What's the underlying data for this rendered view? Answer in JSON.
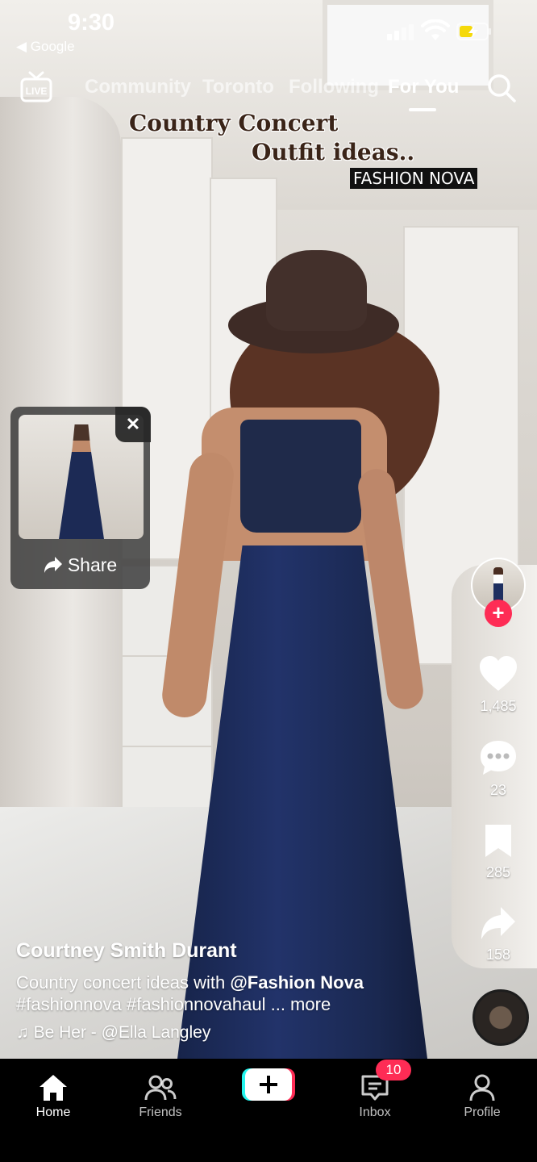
{
  "status_bar": {
    "time": "9:30",
    "back_app": "◀ Google"
  },
  "top_nav": {
    "tabs": [
      "Community",
      "Toronto",
      "Following",
      "For You"
    ],
    "active_tab": "For You",
    "live_label": "LIVE"
  },
  "video_overlay": {
    "line1": "Country Concert",
    "line2": "Outfit ideas..",
    "line3": "FASHION NOVA"
  },
  "share_popup": {
    "label": "Share",
    "close": "✕"
  },
  "actions": {
    "likes": "1,485",
    "comments": "23",
    "saves": "285",
    "shares": "158"
  },
  "caption": {
    "author": "Courtney Smith Durant",
    "text_prefix": "Country concert ideas with ",
    "mention": "@Fashion Nova",
    "hashtags": "#fashionnova #fashionnovahaul",
    "more": "... more",
    "music": "♫ Be Her - @Ella Langley"
  },
  "bottom_nav": {
    "items": [
      "Home",
      "Friends",
      "",
      "Inbox",
      "Profile"
    ],
    "active": "Home",
    "inbox_badge": "10"
  },
  "colors": {
    "accent_red": "#fe2c55",
    "accent_cyan": "#25f4ee"
  }
}
